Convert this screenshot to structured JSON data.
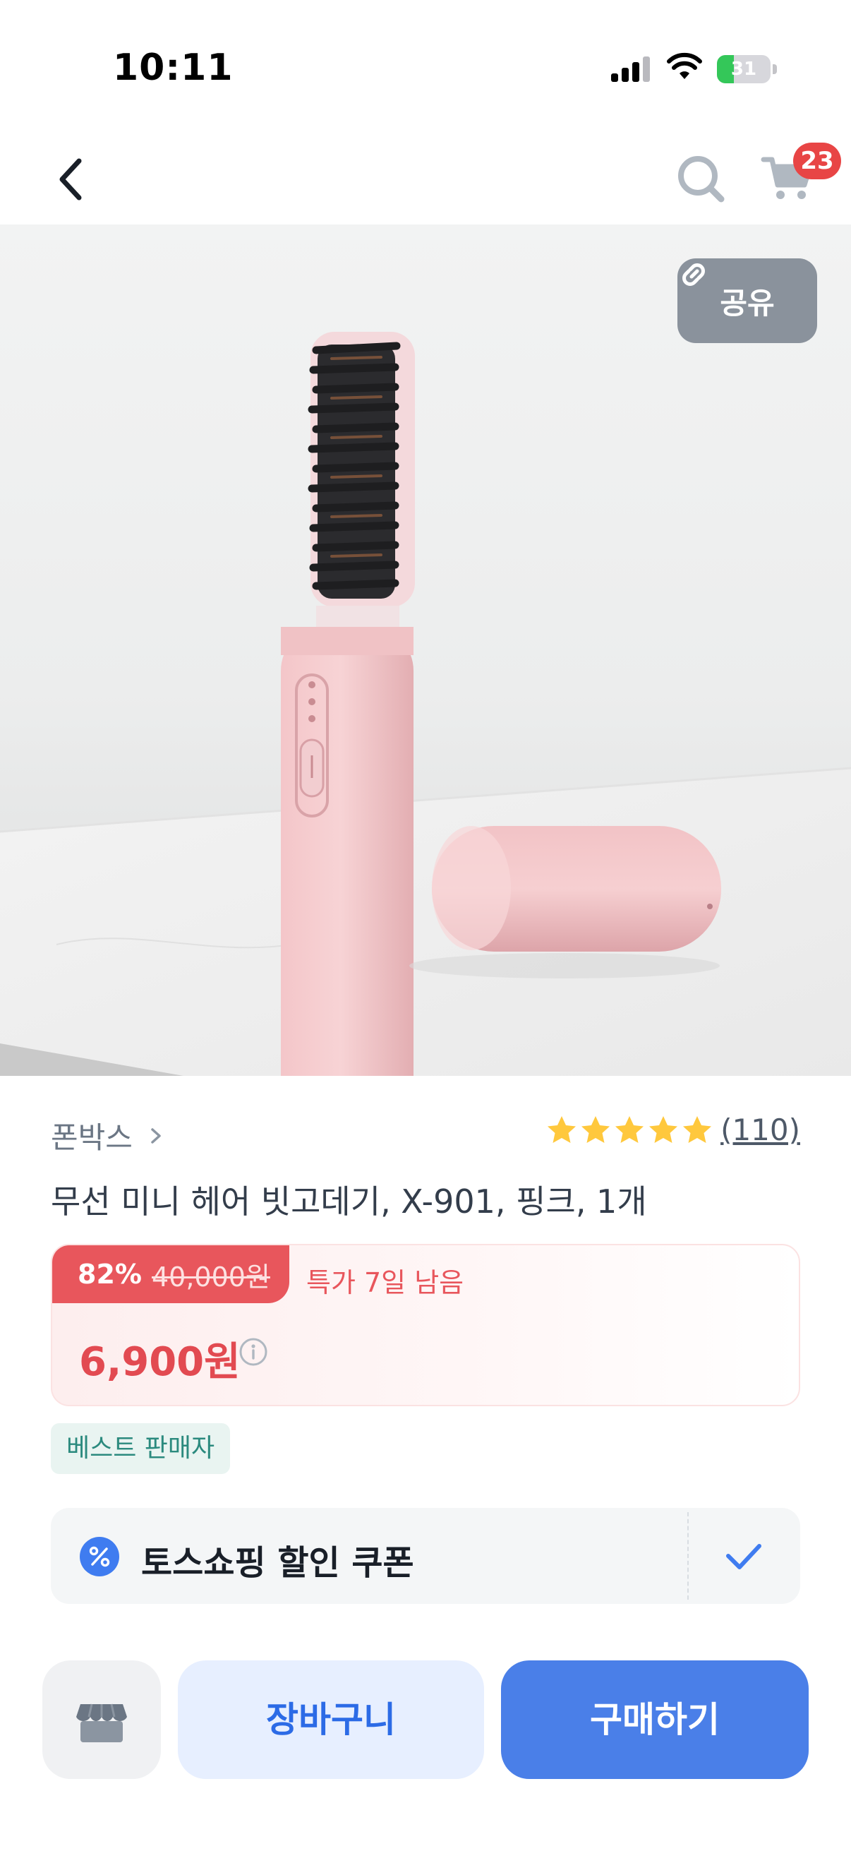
{
  "status_bar": {
    "time": "10:11",
    "battery_level": "31",
    "battery_color": "#34c759"
  },
  "nav": {
    "cart_count": "23",
    "icons": [
      "chevron-left-icon",
      "search-icon",
      "cart-icon"
    ]
  },
  "product_image": {
    "share_label": "공유",
    "alt": "pink hair brush"
  },
  "seller": {
    "name": "폰박스"
  },
  "rating": {
    "stars": 5,
    "review_count": "(110)",
    "star_color": "#ffc83d"
  },
  "product": {
    "title": "무선 미니 헤어 빗고데기, X-901, 핑크, 1개"
  },
  "price": {
    "discount_rate": "82%",
    "original_price": "40,000원",
    "deal_remaining": "특가 7일 남음",
    "sale_price": "6,900원",
    "accent_color": "#e8565c"
  },
  "badge": {
    "label": "베스트 판매자"
  },
  "coupon": {
    "label": "토스쇼핑 할인 쿠폰",
    "applied": true,
    "icon": "percent-icon"
  },
  "actions": {
    "store_icon": "store-icon",
    "cart_label": "장바구니",
    "buy_label": "구매하기",
    "primary_color": "#4a7fe8"
  }
}
